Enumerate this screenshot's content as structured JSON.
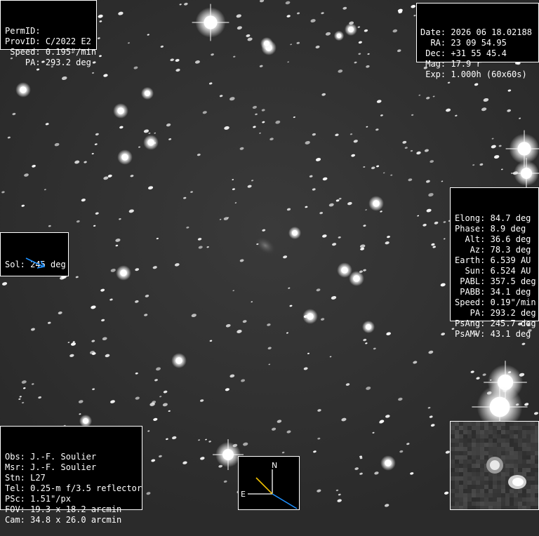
{
  "top_left": [
    {
      "label": "PermID:",
      "value": ""
    },
    {
      "label": "ProvID:",
      "value": "C/2022 E2"
    },
    {
      "label": " Speed:",
      "value": "0.195\"/min"
    },
    {
      "label": "    PA:",
      "value": "293.2 deg"
    }
  ],
  "top_right": [
    {
      "label": "Date:",
      "value": "2026 06 18.02188"
    },
    {
      "label": "  RA:",
      "value": "23 09 54.95"
    },
    {
      "label": " Dec:",
      "value": "+31 55 45.4"
    },
    {
      "label": " Mag:",
      "value": "17.9 r"
    },
    {
      "label": " Exp:",
      "value": "1.000h (60x60s)"
    }
  ],
  "right_mid": [
    {
      "label": "Elong:",
      "value": "84.7 deg"
    },
    {
      "label": "Phase:",
      "value": "8.9 deg"
    },
    {
      "label": "  Alt:",
      "value": "36.6 deg"
    },
    {
      "label": "   Az:",
      "value": "78.3 deg"
    },
    {
      "label": "Earth:",
      "value": "6.539 AU"
    },
    {
      "label": "  Sun:",
      "value": "6.524 AU"
    },
    {
      "label": " PABL:",
      "value": "357.5 deg"
    },
    {
      "label": " PABB:",
      "value": "34.1 deg"
    },
    {
      "label": "Speed:",
      "value": "0.19\"/min"
    },
    {
      "label": "   PA:",
      "value": "293.2 deg"
    },
    {
      "label": "PsAng:",
      "value": "245.7 deg"
    },
    {
      "label": "PsAMV:",
      "value": "43.1 deg"
    }
  ],
  "sol": {
    "label": "Sol:",
    "value": "245 deg",
    "arrow_color": "#1e90ff"
  },
  "bottom_left": [
    {
      "label": "Obs:",
      "value": "J.-F. Soulier"
    },
    {
      "label": "Msr:",
      "value": "J.-F. Soulier"
    },
    {
      "label": "Stn:",
      "value": "L27"
    },
    {
      "label": "Tel:",
      "value": "0.25-m f/3.5 reflector"
    },
    {
      "label": "PSc:",
      "value": "1.51\"/px"
    },
    {
      "label": "FOV:",
      "value": "19.3 x 18.2 arcmin"
    },
    {
      "label": "Cam:",
      "value": "34.8 x 26.0 arcmin"
    }
  ],
  "compass": {
    "north_label": "N",
    "east_label": "E",
    "north_color": "#ffffff",
    "east_color": "#ffffff",
    "motion_color": "#f2c200",
    "sun_color": "#1e90ff"
  }
}
